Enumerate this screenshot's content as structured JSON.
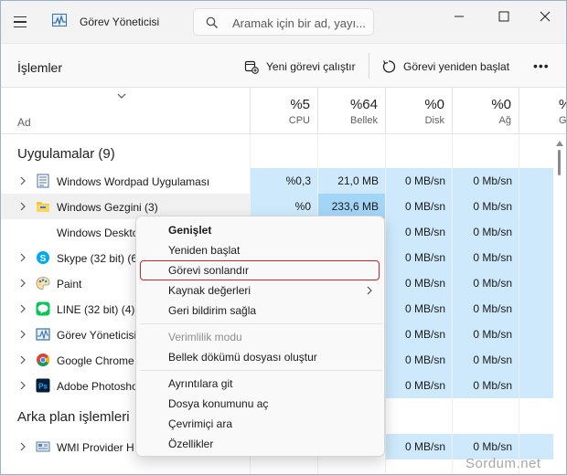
{
  "window": {
    "title": "Görev Yöneticisi",
    "search_placeholder": "Aramak için bir ad, yayı..."
  },
  "toolbar": {
    "page_title": "İşlemler",
    "new_task_label": "Yeni görevi çalıştır",
    "restart_task_label": "Görevi yeniden başlat",
    "more_label": "•••"
  },
  "columns": {
    "name_label": "Ad",
    "cpu": {
      "pct": "%5",
      "label": "CPU"
    },
    "memory": {
      "pct": "%64",
      "label": "Bellek"
    },
    "disk": {
      "pct": "%0",
      "label": "Disk"
    },
    "network": {
      "pct": "%0",
      "label": "Ağ"
    },
    "gpu": {
      "pct": "%",
      "label": "GP"
    }
  },
  "sections": {
    "apps": "Uygulamalar (9)",
    "background": "Arka plan işlemleri"
  },
  "rows": [
    {
      "name": "Windows Wordpad Uygulaması",
      "icon": "wordpad-icon",
      "cpu": "%0,3",
      "memory": "21,0 MB",
      "disk": "0 MB/sn",
      "network": "0 Mb/sn"
    },
    {
      "name": "Windows Gezgini (3)",
      "icon": "folder-icon",
      "cpu": "%0",
      "memory": "233,6 MB",
      "disk": "0 MB/sn",
      "network": "0 Mb/sn"
    },
    {
      "name": "Windows Deskto",
      "icon": "none",
      "cpu": "",
      "memory": "",
      "disk": "0 MB/sn",
      "network": "0 Mb/sn"
    },
    {
      "name": "Skype (32 bit) (6",
      "icon": "skype-icon",
      "cpu": "",
      "memory": "",
      "disk": "0 MB/sn",
      "network": "0 Mb/sn"
    },
    {
      "name": "Paint",
      "icon": "paint-icon",
      "cpu": "",
      "memory": "",
      "disk": "0 MB/sn",
      "network": "0 Mb/sn"
    },
    {
      "name": "LINE (32 bit) (4)",
      "icon": "line-icon",
      "cpu": "",
      "memory": "",
      "disk": "0 MB/sn",
      "network": "0 Mb/sn"
    },
    {
      "name": "Görev Yöneticisi",
      "icon": "task-manager-icon",
      "cpu": "",
      "memory": "",
      "disk": "0 MB/sn",
      "network": "0 Mb/sn"
    },
    {
      "name": "Google Chrome",
      "icon": "chrome-icon",
      "cpu": "",
      "memory": "",
      "disk": "0 MB/sn",
      "network": "0 Mb/sn"
    },
    {
      "name": "Adobe Photosho",
      "icon": "photoshop-icon",
      "cpu": "",
      "memory": "",
      "disk": "0 MB/sn",
      "network": "0 Mb/sn"
    },
    {
      "name": "WMI Provider H",
      "icon": "wmi-icon",
      "cpu": "",
      "memory": "",
      "disk": "0 MB/sn",
      "network": "0 Mb/sn"
    }
  ],
  "context_menu": {
    "items": [
      {
        "label": "Genişlet",
        "state": "bold"
      },
      {
        "label": "Yeniden başlat",
        "state": "normal"
      },
      {
        "label": "Görevi sonlandır",
        "state": "highlighted"
      },
      {
        "label": "Kaynak değerleri",
        "state": "submenu"
      },
      {
        "label": "Geri bildirim sağla",
        "state": "normal"
      },
      {
        "label": "Verimlilik modu",
        "state": "disabled"
      },
      {
        "label": "Bellek dökümü dosyası oluştur",
        "state": "normal"
      },
      {
        "label": "Ayrıntılara git",
        "state": "normal"
      },
      {
        "label": "Dosya konumunu aç",
        "state": "normal"
      },
      {
        "label": "Çevrimiçi ara",
        "state": "normal"
      },
      {
        "label": "Özellikler",
        "state": "normal"
      }
    ]
  },
  "watermark": "Sordum.net",
  "colors": {
    "cell_bg": "#cde9fb",
    "cell_hot_bg": "#a3d5f7",
    "highlight_border": "#d8202a"
  }
}
